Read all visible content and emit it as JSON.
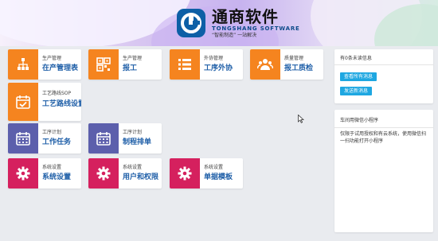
{
  "brand": {
    "name": "通商软件",
    "english": "TONGSHANG SOFTWARE",
    "slogan": "“智能制造” 一站解决"
  },
  "tiles": [
    {
      "category": "生产管理",
      "title": "在产管理表",
      "icon": "sitemap-icon",
      "color": "#f5841f"
    },
    {
      "category": "生产管理",
      "title": "报工",
      "icon": "qr-code-icon",
      "color": "#f5841f"
    },
    {
      "category": "外协管理",
      "title": "工序外协",
      "icon": "list-icon",
      "color": "#f5841f"
    },
    {
      "category": "质量管理",
      "title": "报工质检",
      "icon": "users-icon",
      "color": "#f5841f"
    },
    {
      "category": "工艺路线SOP",
      "title": "工艺路线设置",
      "icon": "calendar-check-icon",
      "color": "#f5841f"
    },
    {
      "category": "工序计划",
      "title": "工作任务",
      "icon": "calendar-icon",
      "color": "#5c5fac"
    },
    {
      "category": "工序计划",
      "title": "制程排单",
      "icon": "calendar-icon",
      "color": "#5c5fac"
    },
    {
      "category": "系统设置",
      "title": "系统设置",
      "icon": "gear-icon",
      "color": "#d5205e"
    },
    {
      "category": "系统设置",
      "title": "用户和权限",
      "icon": "gear-icon",
      "color": "#d5205e"
    },
    {
      "category": "系统设置",
      "title": "单据模板",
      "icon": "gear-icon",
      "color": "#d5205e"
    }
  ],
  "messages_panel": {
    "header": "有0条未读信息",
    "view_all": "查看所有消息",
    "send_new": "发送新消息"
  },
  "miniprogram_panel": {
    "header": "车间用微信小程序",
    "desc": "仅限于试用授权和有云系统，使用微信扫一扫功能打开小程序"
  }
}
